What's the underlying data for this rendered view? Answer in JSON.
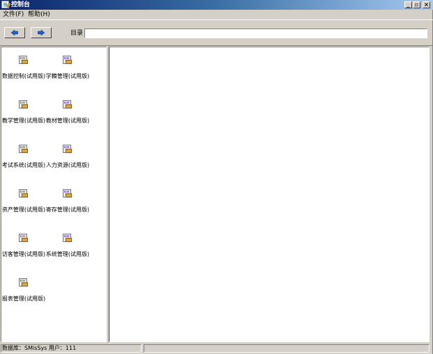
{
  "window": {
    "title": "控制台",
    "minimize_label": "_",
    "maximize_label": "▫",
    "close_label": "×"
  },
  "menu": {
    "file": "文件(F)",
    "help": "帮助(H)"
  },
  "toolbar": {
    "back_icon": "arrow-left-icon",
    "forward_icon": "arrow-right-icon",
    "directory_label": "目录",
    "directory_value": ""
  },
  "modules": [
    {
      "label": "数据控制(试用版)"
    },
    {
      "label": "学籍管理(试用版)"
    },
    {
      "label": "教学管理(试用版)"
    },
    {
      "label": "教材管理(试用版)"
    },
    {
      "label": "考试系统(试用版)"
    },
    {
      "label": "人力资源(试用版)"
    },
    {
      "label": "资产管理(试用版)"
    },
    {
      "label": "寄存管理(试用版)"
    },
    {
      "label": "访客管理(试用版)"
    },
    {
      "label": "系统管理(试用版)"
    },
    {
      "label": "报表管理(试用版)"
    }
  ],
  "status": {
    "db_text": "数据库：SMisSys    用户：111",
    "right_text": ""
  },
  "colors": {
    "face": "#d4d0c8",
    "title_start": "#0a246a",
    "title_end": "#a6caf0",
    "nav_arrow": "#1f5fbf"
  }
}
